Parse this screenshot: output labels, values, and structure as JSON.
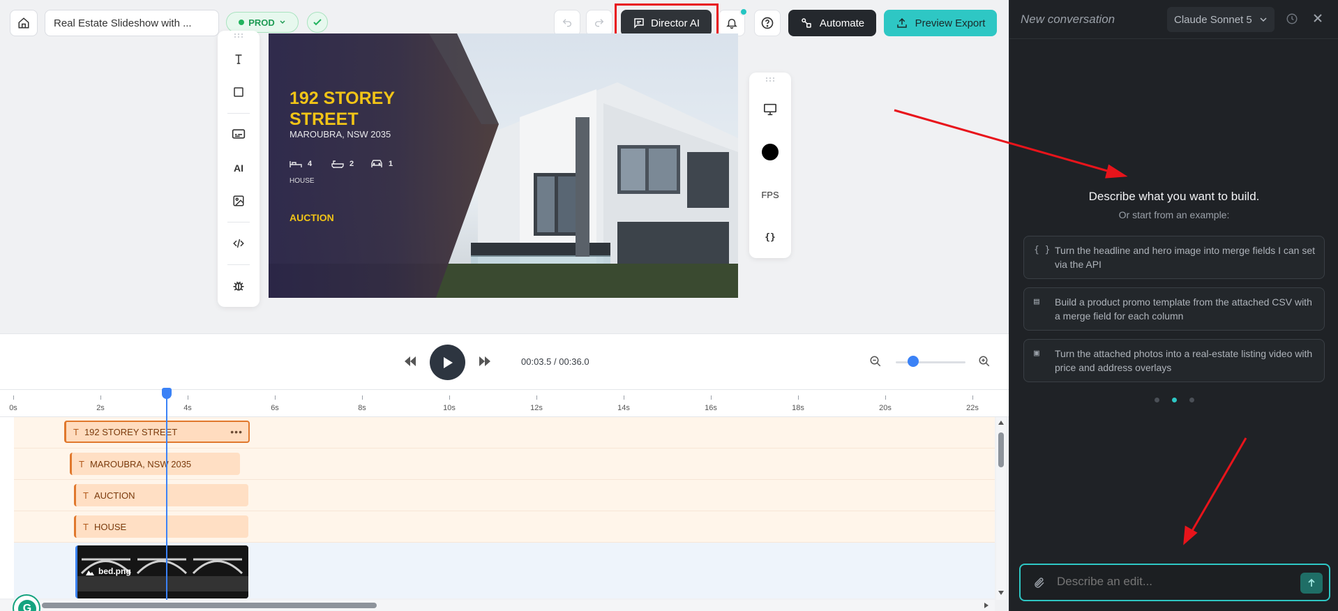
{
  "topbar": {
    "home_icon": "home-icon",
    "project_title": "Real Estate Slideshow with ...",
    "env_badge": "PROD",
    "director_label": "Director AI",
    "automate_label": "Automate",
    "export_label": "Preview Export"
  },
  "left_tools": [
    "text-icon",
    "shape-icon",
    "caption-icon",
    "AI",
    "image-icon",
    "code-icon",
    "bug-icon"
  ],
  "canvas": {
    "title": "192 STOREY STREET",
    "subtitle": "MAROUBRA, NSW 2035",
    "beds": "4",
    "baths": "2",
    "cars": "1",
    "type": "HOUSE",
    "status": "AUCTION",
    "accent_color": "#f1c417"
  },
  "right_tools": {
    "fps_label": "FPS",
    "json_label": "{}"
  },
  "player": {
    "time": "00:03.5 / 00:36.0"
  },
  "timeline": {
    "ticks": [
      "0s",
      "2s",
      "4s",
      "6s",
      "8s",
      "10s",
      "12s",
      "14s",
      "16s",
      "18s",
      "20s",
      "22s"
    ],
    "clips": [
      {
        "label": "192 STOREY STREET",
        "icon": "T"
      },
      {
        "label": "MAROUBRA, NSW 2035",
        "icon": "T"
      },
      {
        "label": "AUCTION",
        "icon": "T"
      },
      {
        "label": "HOUSE",
        "icon": "T"
      }
    ],
    "image_clip": "bed.png"
  },
  "chat": {
    "title": "New conversation",
    "model": "Claude Sonnet 5",
    "heading": "Describe what you want to build.",
    "subheading": "Or start from an example:",
    "examples": [
      {
        "icon": "{ }",
        "text": "Turn the headline and hero image into merge fields I can set via the API"
      },
      {
        "icon": "▤",
        "text": "Build a product promo template from the attached CSV with a merge field for each column"
      },
      {
        "icon": "▣",
        "text": "Turn the attached photos into a real-estate listing video with price and address overlays"
      }
    ],
    "input_placeholder": "Describe an edit..."
  },
  "colors": {
    "accent_teal": "#2ec7c4",
    "highlight_red": "#e8141b",
    "playhead_blue": "#3b82f6"
  }
}
